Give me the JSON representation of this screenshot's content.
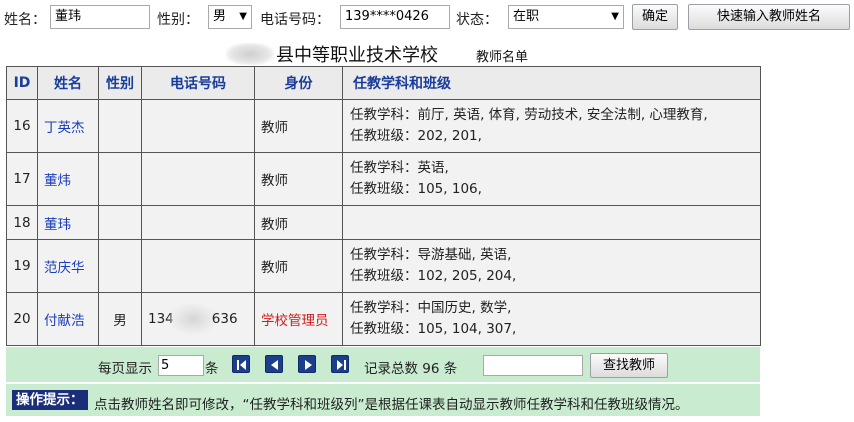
{
  "filters": {
    "name_label": "姓名：",
    "name_value": "董玮",
    "gender_label": "性别：",
    "gender_value": "男",
    "phone_label": "电话号码：",
    "phone_value": "139****0426",
    "status_label": "状态：",
    "status_value": "在职",
    "confirm_label": "确定",
    "quick_input_label": "快速输入教师姓名"
  },
  "title": {
    "school": "县中等职业技术学校",
    "subtitle": "教师名单"
  },
  "table": {
    "headers": [
      "ID",
      "姓名",
      "性别",
      "电话号码",
      "身份",
      "任教学科和班级"
    ],
    "rows": [
      {
        "id": "16",
        "name": "丁英杰",
        "gender": "",
        "phone": "",
        "role": "教师",
        "subjects": "任教学科：前厅, 英语, 体育, 劳动技术, 安全法制, 心理教育,",
        "classes": "任教班级：202, 201,"
      },
      {
        "id": "17",
        "name": "董炜",
        "gender": "",
        "phone": "",
        "role": "教师",
        "subjects": "任教学科：英语,",
        "classes": "任教班级：105, 106,"
      },
      {
        "id": "18",
        "name": "董玮",
        "gender": "",
        "phone": "",
        "role": "教师",
        "subjects": "",
        "classes": ""
      },
      {
        "id": "19",
        "name": "范庆华",
        "gender": "",
        "phone": "",
        "role": "教师",
        "subjects": "任教学科：导游基础, 英语,",
        "classes": "任教班级：102, 205, 204,"
      },
      {
        "id": "20",
        "name": "付献浩",
        "gender": "男",
        "phone_prefix": "134",
        "phone_suffix": "636",
        "role": "学校管理员",
        "subjects": "任教学科：中国历史, 数学,",
        "classes": "任教班级：105, 104, 307,"
      }
    ]
  },
  "pagination": {
    "per_page_label": "每页显示",
    "per_page_value": "5",
    "per_page_unit": "条",
    "total_text": "记录总数 96 条",
    "search_value": "",
    "search_button": "查找教师"
  },
  "hint": {
    "label": "操作提示：",
    "text": "点击教师姓名即可修改，“任教学科和班级列”是根据任课表自动显示教师任教学科和任教班级情况。"
  },
  "colors": {
    "header_text": "#1a3c9a",
    "name_link": "#1a3dbb",
    "admin_role": "#d11a1a",
    "pager_bg": "#c9ecd0",
    "hint_label_bg": "#1a2e7a"
  },
  "icons": [
    "first-page-icon",
    "prev-page-icon",
    "next-page-icon",
    "last-page-icon"
  ]
}
